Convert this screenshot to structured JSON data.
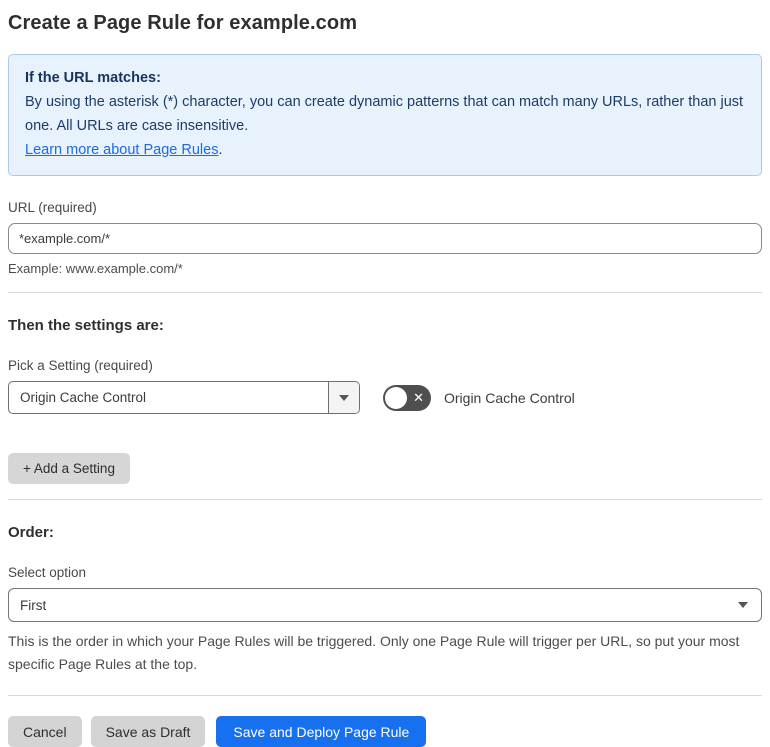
{
  "page": {
    "title": "Create a Page Rule for example.com"
  },
  "info_box": {
    "heading": "If the URL matches:",
    "body": "By using the asterisk (*) character, you can create dynamic patterns that can match many URLs, rather than just one. All URLs are case insensitive.",
    "link_text": "Learn more about Page Rules",
    "link_suffix": "."
  },
  "url_field": {
    "label": "URL (required)",
    "value": "*example.com/*",
    "helper": "Example: www.example.com/*"
  },
  "settings_section": {
    "heading": "Then the settings are:",
    "picker_label": "Pick a Setting (required)",
    "picker_value": "Origin Cache Control",
    "toggle_state": "off",
    "toggle_icon": "✕",
    "toggle_label": "Origin Cache Control",
    "add_button_label": "+ Add a Setting"
  },
  "order_section": {
    "heading": "Order:",
    "select_label": "Select option",
    "select_value": "First",
    "helper": "This is the order in which your Page Rules will be triggered. Only one Page Rule will trigger per URL, so put your most specific Page Rules at the top."
  },
  "footer": {
    "cancel_label": "Cancel",
    "save_draft_label": "Save as Draft",
    "save_deploy_label": "Save and Deploy Page Rule"
  },
  "colors": {
    "primary_blue": "#1670f0",
    "info_background": "#e8f2fc",
    "info_border": "#aacbee",
    "info_text": "#1d3c66",
    "link_blue": "#1b6ce0",
    "toggle_off_gray": "#4f4f4f",
    "button_gray": "#d4d4d4"
  }
}
